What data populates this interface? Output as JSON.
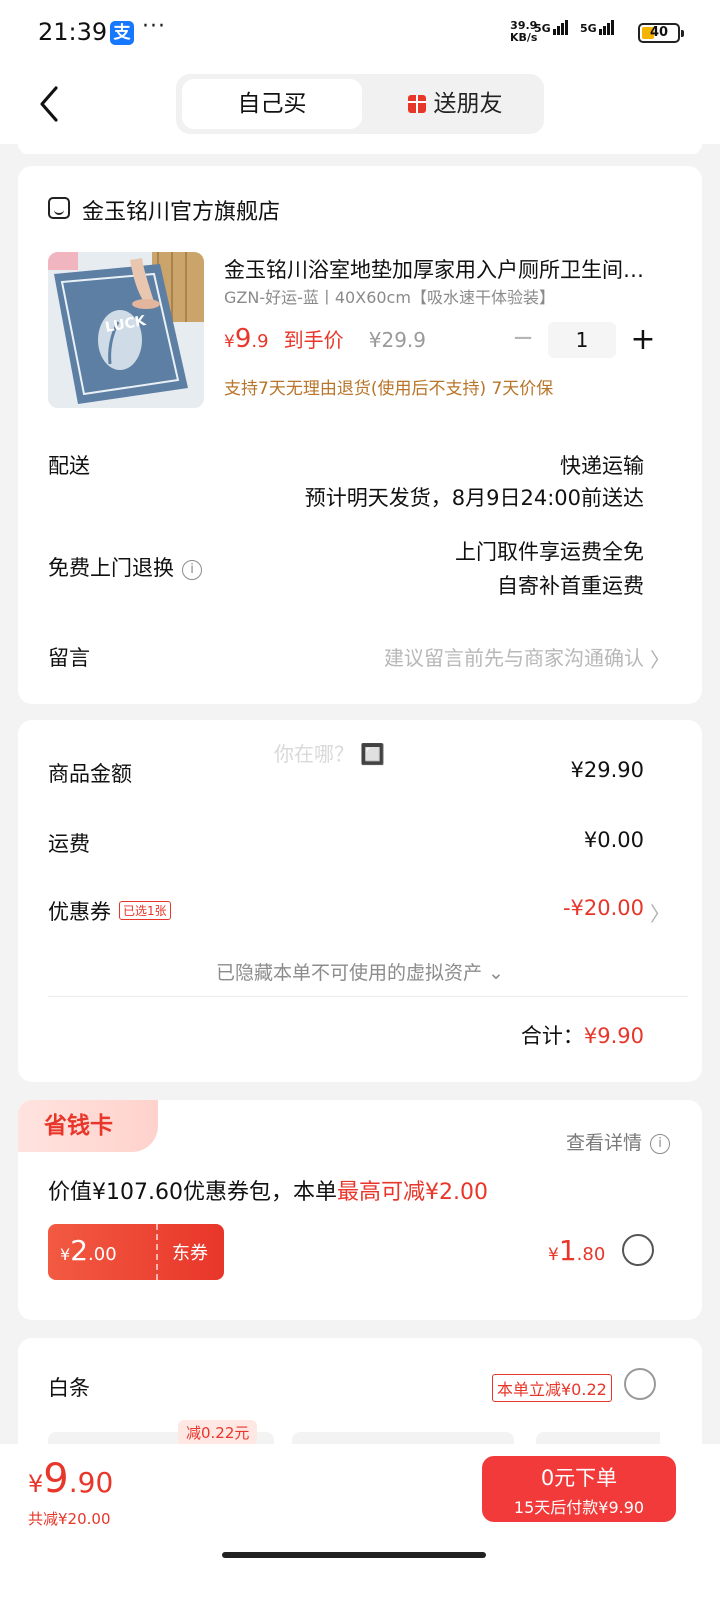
{
  "status": {
    "time": "21:39",
    "app_icon": "支",
    "dots": "···",
    "net_speed_top": "39.9",
    "net_speed_bottom": "KB/s",
    "sig1": "5G",
    "sig2": "5G",
    "battery": "40"
  },
  "nav": {
    "tab_self": "自己买",
    "tab_gift": "送朋友"
  },
  "order": {
    "shop_name": "金玉铭川官方旗舰店",
    "product_title": "金玉铭川浴室地垫加厚家用入户厕所卫生间吸水防滑脚垫",
    "product_spec": "GZN-好运-蓝丨40X60cm【吸水速干体验装】",
    "product_img_text": "LUCK",
    "price_yen": "¥",
    "price_int": "9",
    "price_dec": ".9",
    "price_tag": "到手价",
    "price_old": "¥29.9",
    "qty_minus": "−",
    "qty": "1",
    "qty_plus": "+",
    "service_note": "支持7天无理由退货(使用后不支持) 7天价保",
    "delivery_label": "配送",
    "delivery_method": "快递运输",
    "delivery_eta": "预计明天发货，8月9日24:00前送达",
    "return_label": "免费上门退换",
    "return_line1": "上门取件享运费全免",
    "return_line2": "自寄补首重运费",
    "info_glyph": "i",
    "remark_label": "留言",
    "remark_placeholder": "建议留言前先与商家沟通确认",
    "chevron": "〉"
  },
  "summary": {
    "watermark": "你在哪？ 🔲",
    "goods_label": "商品金额",
    "goods_amount": "¥29.90",
    "shipping_label": "运费",
    "shipping_amount": "¥0.00",
    "coupon_label": "优惠券",
    "coupon_chip": "已选1张",
    "coupon_amount": "-¥20.00",
    "hidden_assets": "已隐藏本单不可使用的虚拟资产 ⌄",
    "total_label": "合计：",
    "total_amount": "¥9.90"
  },
  "saver": {
    "badge": "省钱卡",
    "details_link": "查看详情",
    "desc_prefix": "价值¥107.60优惠券包，本单",
    "desc_highlight": "最高可减¥2.00",
    "ticket_yen": "¥",
    "ticket_int": "2",
    "ticket_dec": ".00",
    "ticket_name": "东券",
    "price_yen": "¥",
    "price_int": "1",
    "price_dec": ".80"
  },
  "baitiao": {
    "label": "白条",
    "promo": "本单立减¥0.22",
    "option_badge": "减0.22元"
  },
  "bottom": {
    "price_yen": "¥",
    "price_int": "9",
    "price_dec": ".90",
    "saved": "共减¥20.00",
    "pay_main": "0元下单",
    "pay_sub": "15天后付款¥9.90"
  },
  "colors": {
    "accent_red": "#e8362a",
    "note_orange": "#b8752a",
    "page_bg": "#f3f3f3"
  }
}
